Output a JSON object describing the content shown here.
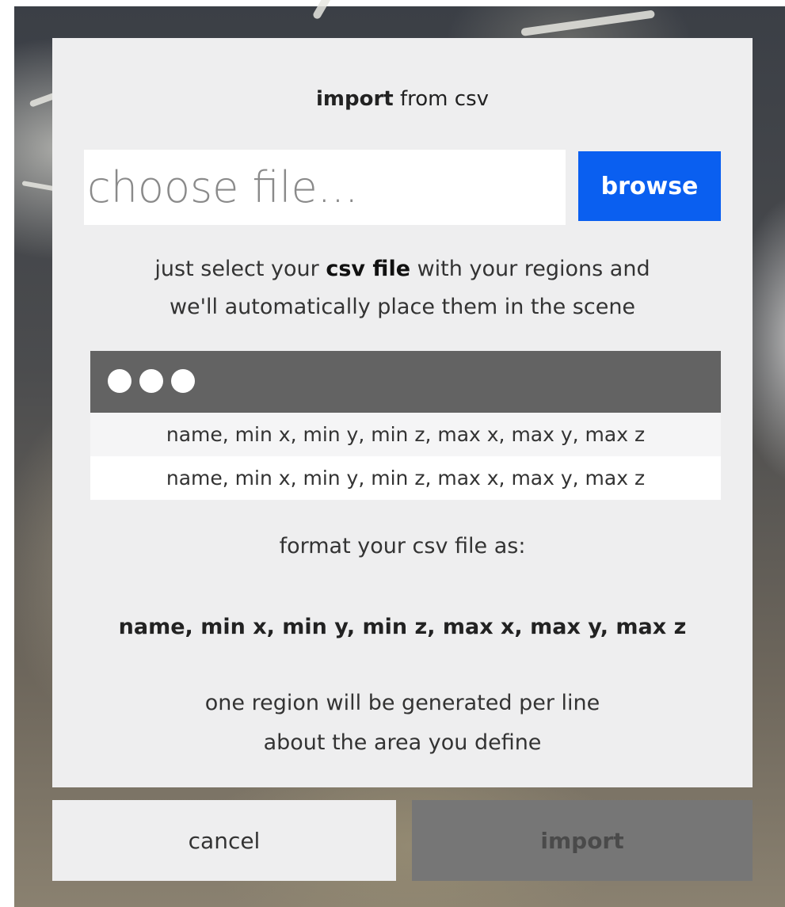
{
  "dialog": {
    "title_bold": "import",
    "title_rest": " from csv",
    "file_input": {
      "placeholder": "choose file...",
      "value": ""
    },
    "browse_label": "browse",
    "description": {
      "part1": "just select your ",
      "bold": "csv file",
      "part2": " with your regions and",
      "line2": "we'll automatically place them in the scene"
    },
    "example_window": {
      "dot_icon": "circle-dot-icon",
      "rows": [
        "name, min x, min y, min z, max x, max y, max z",
        "name, min x, min y, min z, max x, max y, max z"
      ]
    },
    "format_label": "format your csv file as:",
    "format_spec": "name, min x, min y, min z, max x, max y, max z",
    "note_line1": "one region will be generated per line",
    "note_line2": "about the area you define"
  },
  "actions": {
    "cancel_label": "cancel",
    "import_label": "import"
  },
  "colors": {
    "accent": "#0a5ff0",
    "panel": "#eeeeef",
    "titlebar": "#636363",
    "import_disabled": "#767676"
  }
}
